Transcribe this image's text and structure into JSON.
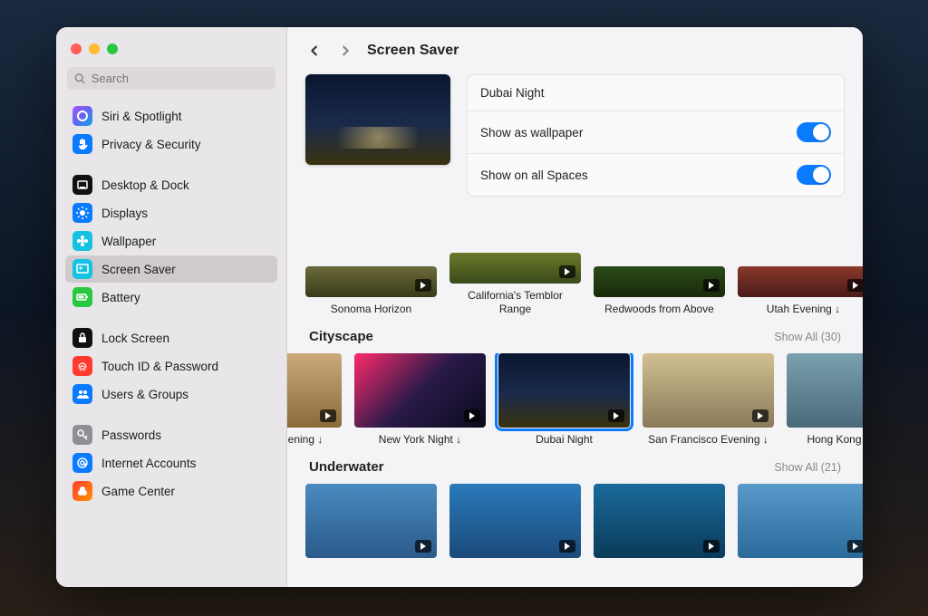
{
  "sidebar": {
    "search_placeholder": "Search",
    "items": [
      {
        "label": "Siri & Spotlight",
        "bg": "linear-gradient(135deg,#a855f7,#6366f1,#0ea5e9)",
        "icon": "siri"
      },
      {
        "label": "Privacy & Security",
        "bg": "#0a7aff",
        "icon": "hand"
      },
      {
        "gap": true
      },
      {
        "label": "Desktop & Dock",
        "bg": "#111",
        "icon": "dock"
      },
      {
        "label": "Displays",
        "bg": "#0a7aff",
        "icon": "sun"
      },
      {
        "label": "Wallpaper",
        "bg": "#16c2e2",
        "icon": "flower"
      },
      {
        "label": "Screen Saver",
        "bg": "#16c2e2",
        "icon": "screensaver",
        "selected": true
      },
      {
        "label": "Battery",
        "bg": "#28c840",
        "icon": "battery"
      },
      {
        "gap": true
      },
      {
        "label": "Lock Screen",
        "bg": "#111",
        "icon": "lock"
      },
      {
        "label": "Touch ID & Password",
        "bg": "#ff3b30",
        "icon": "fingerprint"
      },
      {
        "label": "Users & Groups",
        "bg": "#0a7aff",
        "icon": "users"
      },
      {
        "gap": true
      },
      {
        "label": "Passwords",
        "bg": "#8e8e93",
        "icon": "key"
      },
      {
        "label": "Internet Accounts",
        "bg": "#0a7aff",
        "icon": "at"
      },
      {
        "label": "Game Center",
        "bg": "linear-gradient(135deg,#ff3b30,#ff9500)",
        "icon": "game"
      }
    ]
  },
  "header": {
    "title": "Screen Saver"
  },
  "current": {
    "name": "Dubai Night",
    "settings": [
      {
        "label": "Show as wallpaper",
        "on": true
      },
      {
        "label": "Show on all Spaces",
        "on": true
      }
    ]
  },
  "sections": [
    {
      "title": null,
      "show_all": null,
      "offset": false,
      "items": [
        {
          "label": "Sonoma Horizon",
          "bg": "linear-gradient(180deg,#6b6b3a,#3a3a1a)"
        },
        {
          "label": "California's Temblor Range",
          "bg": "linear-gradient(180deg,#6a7a2a,#3a4a1a)"
        },
        {
          "label": "Redwoods from Above",
          "bg": "linear-gradient(180deg,#2a4a1a,#1a2a0a)"
        },
        {
          "label": "Utah Evening ↓",
          "bg": "linear-gradient(180deg,#8a3a2a,#4a1a1a)"
        }
      ]
    },
    {
      "title": "Cityscape",
      "show_all": "Show All (30)",
      "offset": true,
      "items": [
        {
          "label": "ening ↓",
          "bg": "linear-gradient(180deg,#caa97a,#8a6a3a)",
          "half": true
        },
        {
          "label": "New York Night ↓",
          "bg": "linear-gradient(135deg,#ff2a6a,#2a1a4a,#0a0a1a)"
        },
        {
          "label": "Dubai Night",
          "bg": "linear-gradient(180deg,#0a1630,#1a2a4a 55%,#3a3210)",
          "selected": true
        },
        {
          "label": "San Francisco Evening ↓",
          "bg": "linear-gradient(180deg,#d0c090,#8a7a5a)"
        },
        {
          "label": "Hong Kong Harbor",
          "bg": "linear-gradient(180deg,#7aa0b0,#4a6a7a)"
        }
      ]
    },
    {
      "title": "Underwater",
      "show_all": "Show All (21)",
      "offset": false,
      "items": [
        {
          "label": "",
          "bg": "linear-gradient(180deg,#4a8ac0,#2a5a8a)"
        },
        {
          "label": "",
          "bg": "linear-gradient(180deg,#2a7aba,#1a4a7a)"
        },
        {
          "label": "",
          "bg": "linear-gradient(180deg,#1a6a9a,#0a3a5a)"
        },
        {
          "label": "",
          "bg": "linear-gradient(180deg,#5a9aca,#2a6a9a)"
        }
      ]
    }
  ]
}
